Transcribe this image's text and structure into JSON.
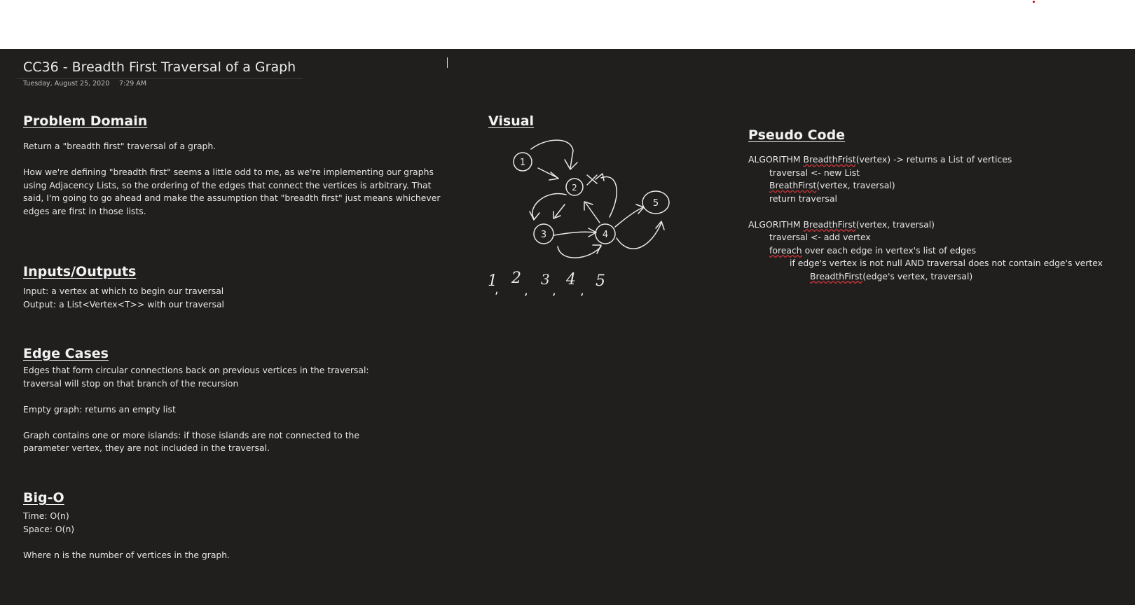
{
  "page": {
    "title": "CC36 - Breadth First Traversal of a Graph",
    "date": "Tuesday, August 25, 2020",
    "time": "7:29 AM"
  },
  "problem_domain": {
    "heading": "Problem Domain",
    "p1": "Return a \"breadth first\" traversal of a graph.",
    "p2_lines": [
      "How we're defining \"breadth first\" seems a little odd to me, as we're implementing our graphs",
      "using Adjacency Lists, so the ordering of the edges that connect the vertices is arbitrary. That",
      "said, I'm going to go ahead and make the assumption that \"breadth first\" just means whichever",
      "edges are first in those lists."
    ]
  },
  "inputs_outputs": {
    "heading": "Inputs/Outputs",
    "input": "Input: a vertex at which to begin our traversal",
    "output": "Output: a List<Vertex<T>> with our traversal"
  },
  "edge_cases": {
    "heading": "Edge Cases",
    "case1_lines": [
      "Edges that form circular connections back on previous vertices in the traversal:",
      "traversal will stop on that branch of the recursion"
    ],
    "case2": "Empty graph: returns an empty list",
    "case3_lines": [
      "Graph contains one or more islands: if those islands are not connected to the",
      "parameter vertex, they are not included in the traversal."
    ]
  },
  "big_o": {
    "heading": "Big-O",
    "time": "Time: O(n)",
    "space": "Space: O(n)",
    "note": "Where n is the number of vertices in the graph."
  },
  "visual": {
    "heading": "Visual",
    "nodes": [
      "1",
      "2",
      "3",
      "4",
      "5"
    ],
    "sequence": [
      "1",
      "2",
      "3",
      "4",
      "5"
    ]
  },
  "pseudo": {
    "heading": "Pseudo Code",
    "algo1": {
      "pre": "ALGORITHM ",
      "name": "BreadthFrist",
      "post": "(vertex) -> returns a List of vertices"
    },
    "algo1_l1": "traversal <- new List",
    "algo1_l2": {
      "name": "BreathFirst",
      "post": "(vertex, traversal)"
    },
    "algo1_l3": "return traversal",
    "algo2": {
      "pre": "ALGORITHM ",
      "name": "BreadthFirst",
      "post": "(vertex, traversal)"
    },
    "algo2_l1": "traversal <- add vertex",
    "algo2_l2": {
      "name": "foreach",
      "post": " over each edge in vertex's list of edges"
    },
    "algo2_l3": "if edge's vertex is not null AND traversal does not contain edge's vertex",
    "algo2_l4": {
      "name": "BreadthFirst",
      "post": "(edge's vertex, traversal)"
    }
  },
  "colors": {
    "canvas_bg": "#201f1e",
    "top_bg": "#ffffff",
    "text": "#e6e6e6",
    "spell_underline": "#d13438"
  }
}
